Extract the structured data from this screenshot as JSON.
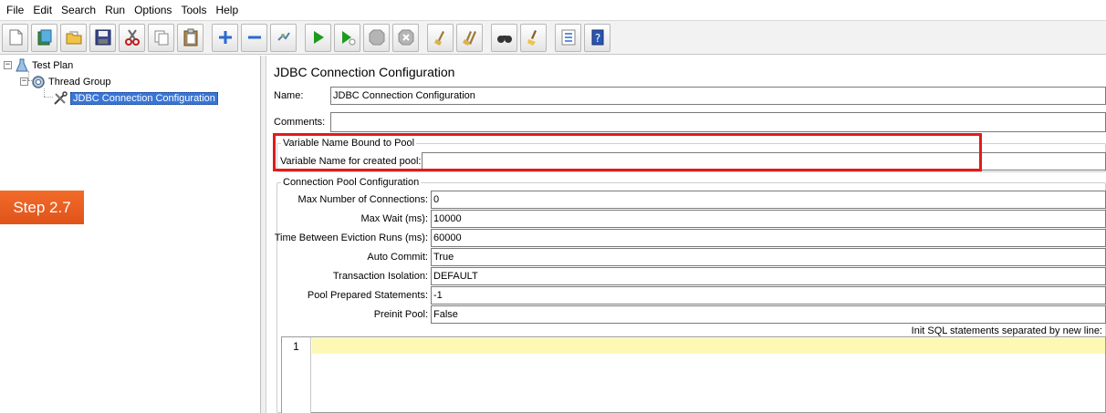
{
  "menu": [
    "File",
    "Edit",
    "Search",
    "Run",
    "Options",
    "Tools",
    "Help"
  ],
  "toolbar": {
    "buttons": [
      "new-icon",
      "templates-icon",
      "open-icon",
      "save-icon",
      "cut-icon",
      "copy-icon",
      "paste-icon",
      "expand-icon",
      "collapse-icon",
      "toggle-icon",
      "start-icon",
      "start-no-timers-icon",
      "stop-icon",
      "shutdown-icon",
      "clear-icon",
      "clear-all-icon",
      "search-icon",
      "reset-search-icon",
      "function-helper-icon",
      "help-icon"
    ]
  },
  "tree": {
    "test_plan": "Test Plan",
    "thread_group": "Thread Group",
    "jdbc_config": "JDBC Connection Configuration"
  },
  "badge": "Step 2.7",
  "panel": {
    "title": "JDBC Connection Configuration",
    "name_label": "Name:",
    "name_value": "JDBC Connection Configuration",
    "comments_label": "Comments:",
    "comments_value": "",
    "pool_group_title": "Variable Name Bound to Pool",
    "pool_var_label": "Variable Name for created pool:",
    "pool_var_value": "",
    "conn_group_title": "Connection Pool Configuration",
    "fields": [
      {
        "label": "Max Number of Connections:",
        "value": "0"
      },
      {
        "label": "Max Wait (ms):",
        "value": "10000"
      },
      {
        "label": "Time Between Eviction Runs (ms):",
        "value": "60000"
      },
      {
        "label": "Auto Commit:",
        "value": "True"
      },
      {
        "label": "Transaction Isolation:",
        "value": "DEFAULT"
      },
      {
        "label": "Pool Prepared Statements:",
        "value": "-1"
      },
      {
        "label": "Preinit Pool:",
        "value": "False"
      }
    ],
    "init_sql_label": "Init SQL statements separated by new line:",
    "line_number": "1"
  },
  "colors": {
    "highlight": "#e11b1b",
    "badge": "#e85d22",
    "selection": "#3875d7"
  }
}
